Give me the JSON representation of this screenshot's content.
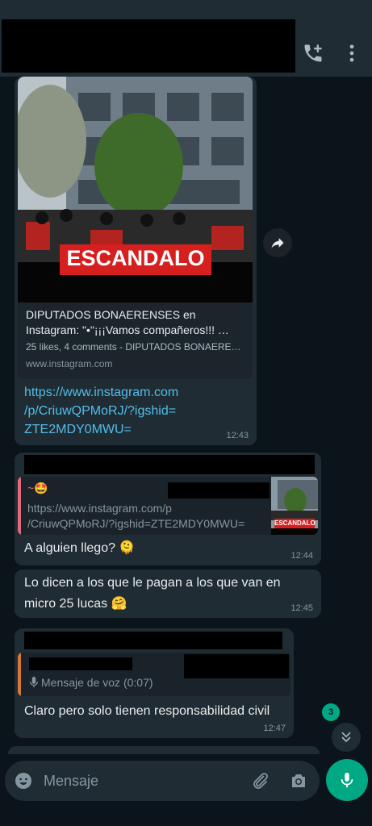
{
  "header": {
    "call_icon": "add-call-icon",
    "menu_icon": "more-vert-icon"
  },
  "messages": [
    {
      "preview": {
        "banner": "ESCANDALO",
        "title_line1": "DIPUTADOS BONAERENSES en",
        "title_line2": "Instagram: \"•\"¡¡¡Vamos compañeros!!! …",
        "desc": "25 likes, 4 comments - DIPUTADOS BONAEREN…",
        "domain": "www.instagram.com"
      },
      "link_lines": [
        "https://www.instagram.com",
        "/p/CriuwQPMoRJ/?igshid=",
        "ZTE2MDY0MWU="
      ],
      "time": "12:43"
    },
    {
      "quote_author": "~🤩",
      "quote_line1": "https://www.instagram.com/p",
      "quote_line2": "/CriuwQPMoRJ/?igshid=ZTE2MDY0MWU=",
      "thumb_banner": "ESCANDALO",
      "text": "A alguien llego? 🫠",
      "time": "12:44"
    },
    {
      "line1": "Lo dicen a los que le pagan a los que van en",
      "line2": "micro 25 lucas 🤗",
      "time": "12:45"
    },
    {
      "quote_text": "Mensaje de voz (0:07)",
      "text": "Claro pero solo tienen responsabilidad civil",
      "time": "12:47"
    }
  ],
  "scroll": {
    "unread": "3"
  },
  "composer": {
    "placeholder": "Mensaje"
  },
  "colors": {
    "accent": "#00a884",
    "link": "#53bdeb",
    "bubble": "#202c33",
    "background": "#0b141a"
  }
}
